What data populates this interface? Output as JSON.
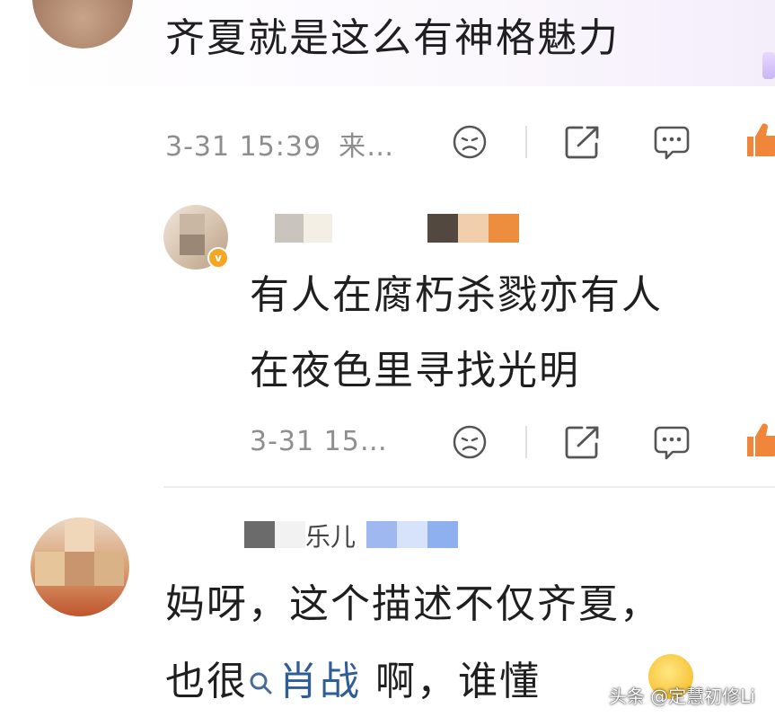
{
  "comments": [
    {
      "text": "齐夏就是这么有神格魅力",
      "time": "3-31 15:39",
      "source": "来…"
    },
    {
      "text_line1": "有人在腐朽杀戮亦有人",
      "text_line2": "在夜色里寻找光明",
      "time": "3-31 15…"
    },
    {
      "username_fragment": "乐儿",
      "text_line1": "妈呀，这个描述不仅齐夏，",
      "text_prefix": "也很",
      "mention": "肖战",
      "text_suffix": " 啊，谁懂"
    }
  ],
  "icons": [
    "dislike-icon",
    "share-icon",
    "comment-icon",
    "like-icon",
    "verified-badge-icon",
    "search-icon"
  ],
  "watermark": "头条 @定慧初修Li",
  "colors": {
    "meta": "#8e8e8e",
    "mention": "#2f5d95",
    "like": "#f0863a"
  }
}
